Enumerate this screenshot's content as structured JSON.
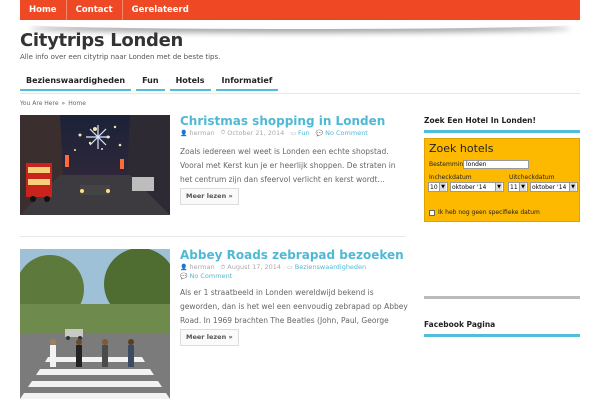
{
  "top_nav": {
    "items": [
      "Home",
      "Contact",
      "Gerelateerd"
    ]
  },
  "site": {
    "title": "Citytrips Londen",
    "tagline": "Alle info over een citytrip naar Londen met de beste tips."
  },
  "category_nav": {
    "items": [
      "Bezienswaardigheden",
      "Fun",
      "Hotels",
      "Informatief"
    ]
  },
  "breadcrumb": {
    "prefix": "You Are Here",
    "separator": "»",
    "current": "Home"
  },
  "posts": [
    {
      "title": "Christmas shopping in Londen",
      "author": "herman",
      "date": "October 21, 2014",
      "category": "Fun",
      "comments": "No Comment",
      "excerpt": "Zoals iedereen wel weet is Londen een echte shopstad. Vooral met Kerst kun je er heerlijk shoppen. De straten in het centrum zijn dan sfeervol verlicht en kerst wordt…",
      "read_more": "Meer lezen »"
    },
    {
      "title": "Abbey Roads zebrapad bezoeken",
      "author": "herman",
      "date": "August 17, 2014",
      "category": "Bezienswaardigheden",
      "comments": "No Comment",
      "excerpt": "Als er 1 straatbeeld in Londen wereldwijd bekend is geworden, dan is het wel een eenvoudig zebrapad op Abbey Road. In 1969 brachten The Beatles (John, Paul, George en…",
      "read_more": "Meer lezen »"
    }
  ],
  "sidebar": {
    "hotel_widget_title": "Zoek Een Hotel In Londen!",
    "facebook_widget_title": "Facebook Pagina",
    "hotel_search": {
      "title": "Zoek hotels",
      "destination_label": "Bestemming",
      "destination_value": "londen",
      "checkin_label": "Incheckdatum",
      "checkout_label": "Uitcheckdatum",
      "checkin_day": "10",
      "checkin_month": "oktober '14",
      "checkout_day": "11",
      "checkout_month": "oktober '14",
      "no_dates_label": "Ik heb nog geen specifieke datum"
    }
  },
  "colors": {
    "accent_red": "#ee4924",
    "accent_blue": "#4fb9d5",
    "widget_yellow": "#fcb900"
  },
  "icons": {
    "author": "user-icon",
    "date": "clock-icon",
    "category": "folder-icon",
    "comments": "comment-icon"
  }
}
